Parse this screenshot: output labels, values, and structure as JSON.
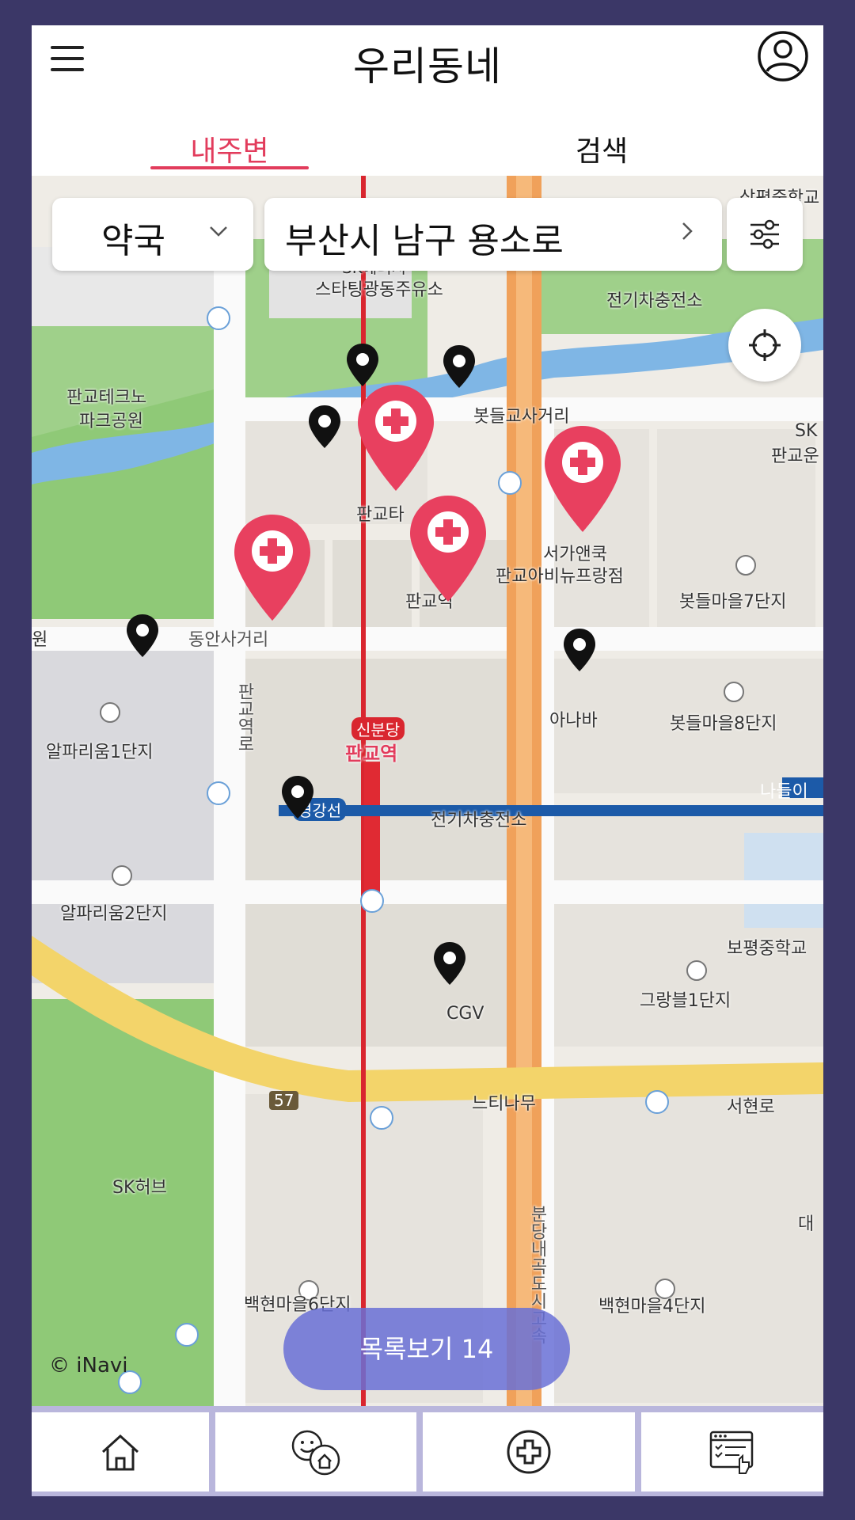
{
  "header": {
    "title": "우리동네",
    "tabs": [
      {
        "label": "내주변",
        "active": true
      },
      {
        "label": "검색",
        "active": false
      }
    ]
  },
  "filters": {
    "category": "약국",
    "address": "부산시 남구 용소로"
  },
  "map": {
    "copyright": "© iNavi",
    "labels": [
      "판교테크노",
      "파크공원",
      "스타팅광동주유소",
      "SK에너지",
      "전기차충전소",
      "봇들교사거리",
      "판교타",
      "판교역",
      "서가앤쿡",
      "판교아비뉴프랑점",
      "봇들마을7단지",
      "동안사거리",
      "판교역로",
      "신분당",
      "판교역",
      "아나바",
      "봇들마을8단지",
      "알파리움1단지",
      "경강선",
      "전기차충전소",
      "알파리움2단지",
      "보평중학교",
      "CGV",
      "그랑블1단지",
      "57",
      "느티나무",
      "서현로",
      "SK허브",
      "백현마을6단지",
      "백현마을4단지",
      "분당내곡도시고속",
      "삼평중학교",
      "SK",
      "판교운",
      "나들이",
      "대",
      "원"
    ]
  },
  "list_button": {
    "label": "목록보기 14"
  },
  "bottom_nav": {
    "items": [
      {
        "icon": "home-icon"
      },
      {
        "icon": "community-icon"
      },
      {
        "icon": "hospital-cross-icon"
      },
      {
        "icon": "records-icon"
      }
    ]
  },
  "colors": {
    "background": "#3b3767",
    "accent": "#e23c5c",
    "list_button": "#6870d6",
    "nav_bar": "#b9b6dc"
  }
}
